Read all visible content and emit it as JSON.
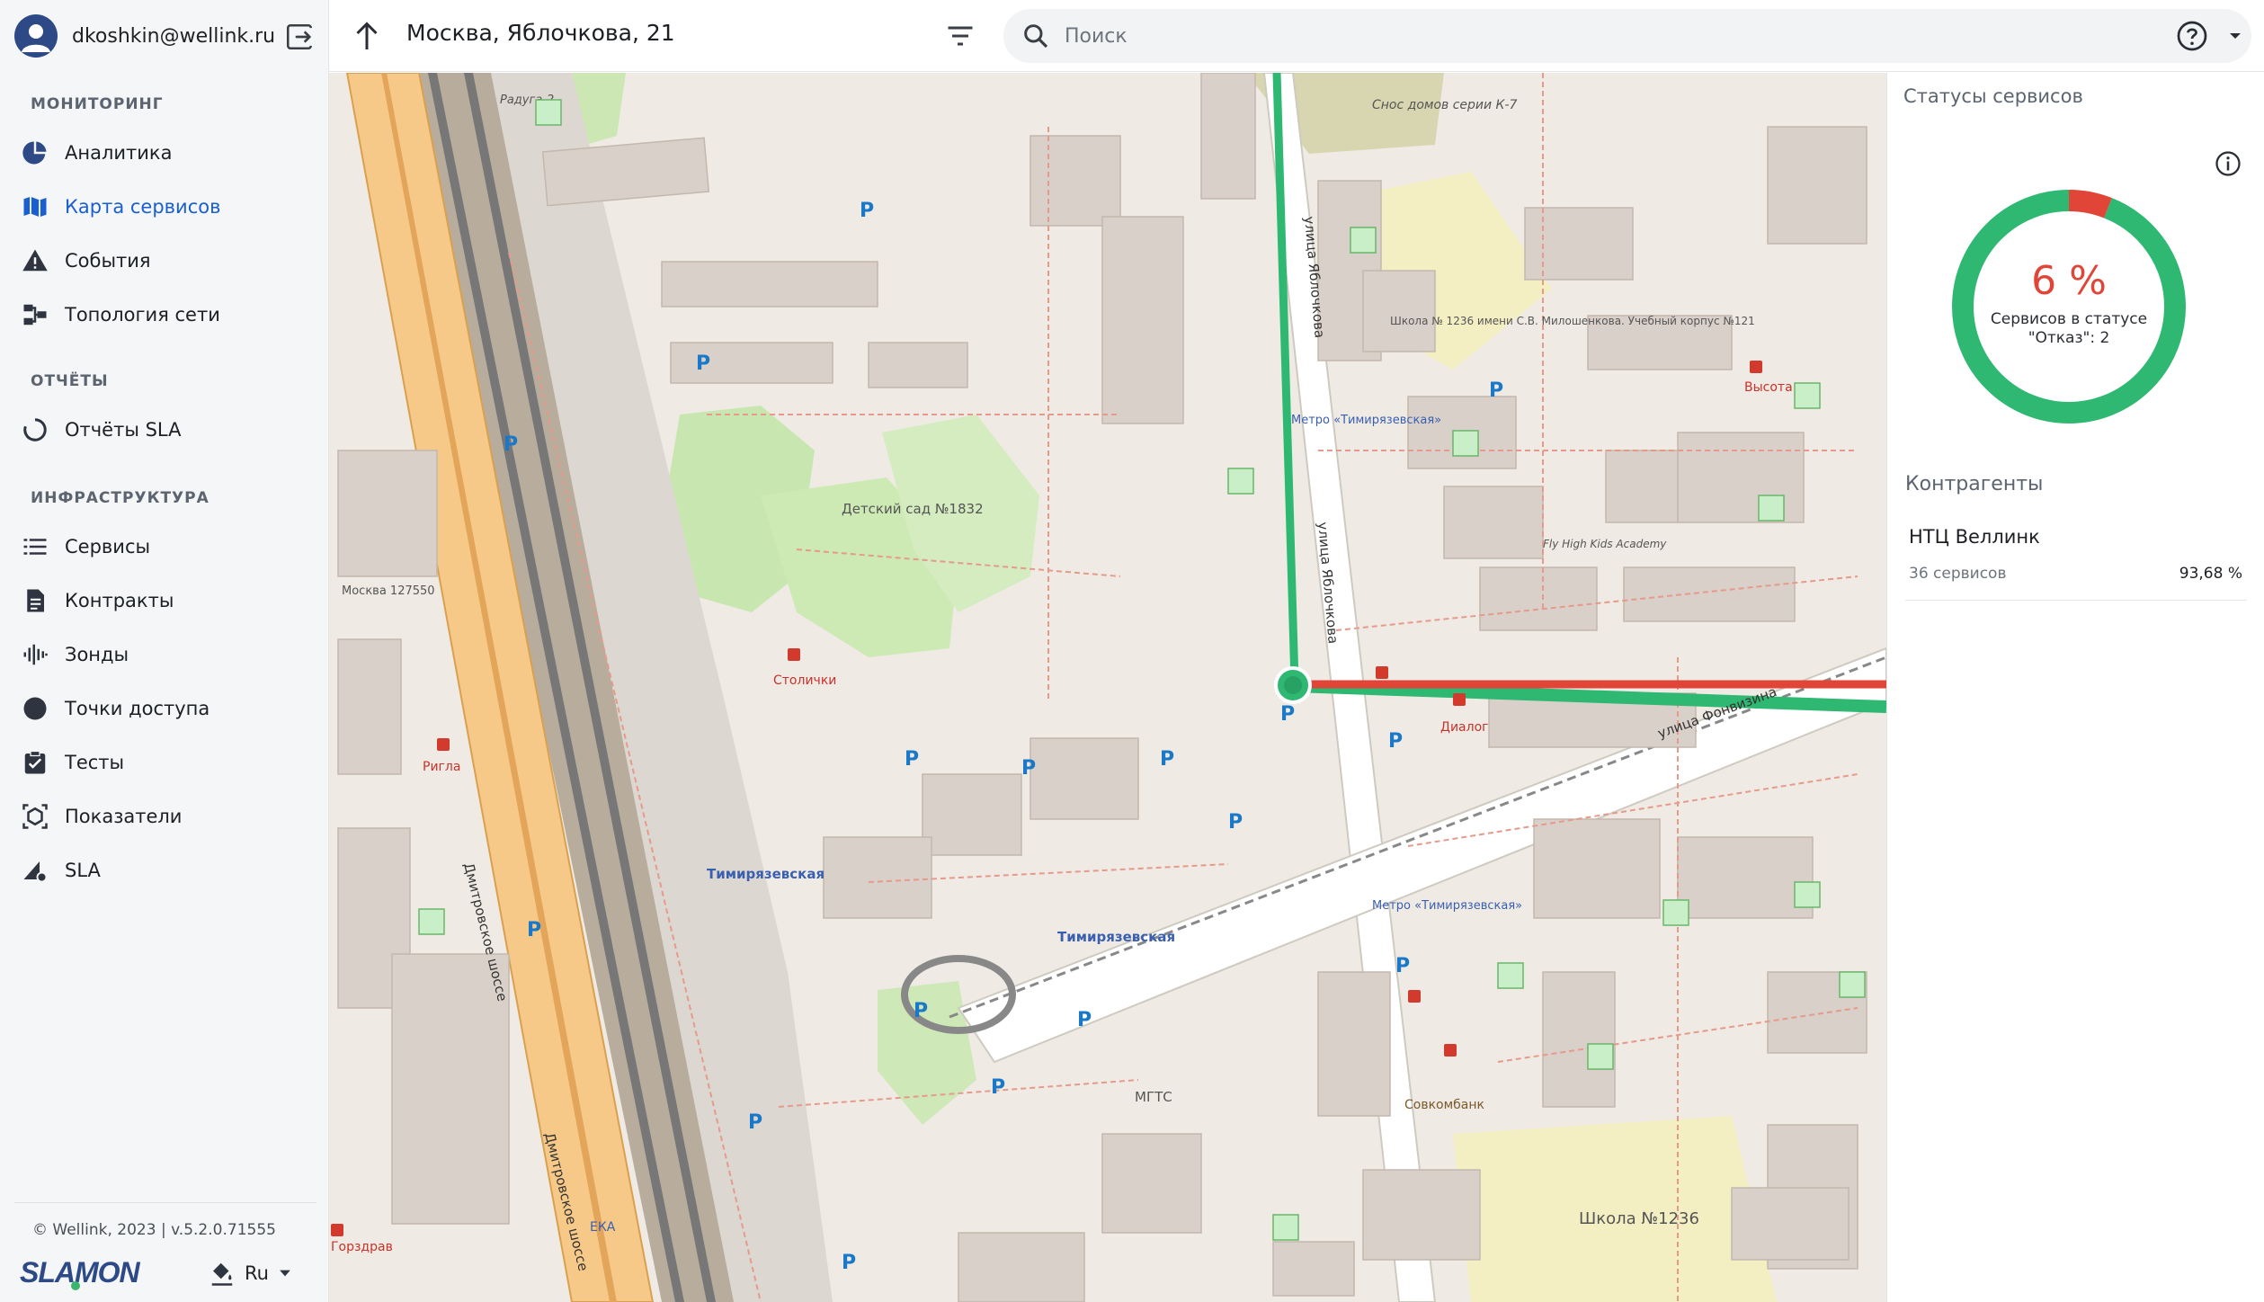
{
  "user": {
    "email": "dkoshkin@wellink.ru"
  },
  "sidebar": {
    "sections": [
      "МОНИТОРИНГ",
      "ОТЧЁТЫ",
      "ИНФРАСТРУКТУРА"
    ],
    "items": [
      {
        "label": "Аналитика",
        "icon": "analytics-icon"
      },
      {
        "label": "Карта сервисов",
        "icon": "map-icon",
        "active": true
      },
      {
        "label": "События",
        "icon": "warning-icon"
      },
      {
        "label": "Топология сети",
        "icon": "topology-icon"
      },
      {
        "label": "Отчёты SLA",
        "icon": "refresh-icon"
      },
      {
        "label": "Сервисы",
        "icon": "list-icon"
      },
      {
        "label": "Контракты",
        "icon": "document-icon"
      },
      {
        "label": "Зонды",
        "icon": "signal-icon"
      },
      {
        "label": "Точки доступа",
        "icon": "circle-icon"
      },
      {
        "label": "Тесты",
        "icon": "checklist-icon"
      },
      {
        "label": "Показатели",
        "icon": "cube-icon"
      },
      {
        "label": "SLA",
        "icon": "sla-icon"
      }
    ],
    "footer": {
      "copyright": "© Wellink, 2023 | v.5.2.0.71555",
      "lang": "Ru",
      "logo_text": "SLAMON"
    }
  },
  "header": {
    "title": "Москва, Яблочкова, 21",
    "search_placeholder": "Поиск"
  },
  "map": {
    "labels": {
      "street1": "Дмитровское шоссе",
      "street2": "улица Яблочкова",
      "street3": "улица Фонвизина",
      "station1": "Тимирязевская",
      "metro": "Метро «Тимирязевская»",
      "kindergarten": "Детский сад №1832",
      "school": "Школа №1236",
      "school_main": "Школа № 1236 имени С.В. Милошенкова. Учебный корпус №121",
      "stolichki": "Столички",
      "rigla": "Ригла",
      "dialog": "Диалог",
      "sovcom": "Совкомбанк",
      "vysota": "Высота",
      "mgts": "МГТС",
      "gorzdrav": "Горздрав",
      "eka": "ЕКА",
      "flyhigh": "Fly High Kids Academy",
      "snos": "Снос домов серии К-7",
      "moskva": "Москва 127550",
      "radug": "Радуга-2"
    },
    "colors": {
      "ok": "#2eb872",
      "fail": "#e04537"
    }
  },
  "panel": {
    "title": "Статусы сервисов",
    "donut": {
      "fail_percent": 6,
      "pct_text": "6 %",
      "caption": "Сервисов в статусе \"Отказ\": 2",
      "ok_color": "#2eb872",
      "fail_color": "#e04537"
    },
    "section2": "Контрагенты",
    "counterparty": {
      "name": "НТЦ Веллинк",
      "count": "36 сервисов",
      "pct": "93,68 %"
    }
  }
}
